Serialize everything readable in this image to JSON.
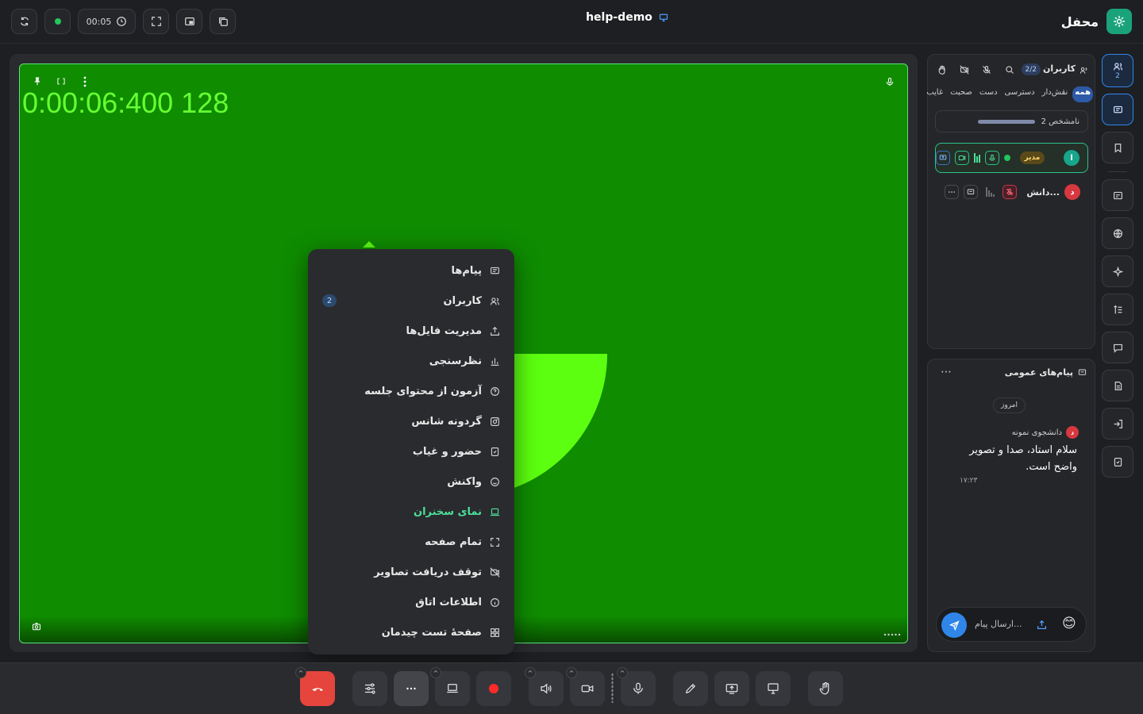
{
  "header": {
    "brand": "محفل",
    "room_title": "help-demo",
    "timer": "00:05"
  },
  "stage": {
    "timestamp": "0:00:06:400 128"
  },
  "menu": {
    "items": [
      {
        "label": "پیام‌ها",
        "icon": "message-icon"
      },
      {
        "label": "کاربران",
        "icon": "users-icon",
        "badge": "2"
      },
      {
        "label": "مدیریت فایل‌ها",
        "icon": "upload-icon"
      },
      {
        "label": "نظرسنجی",
        "icon": "chart-icon"
      },
      {
        "label": "آزمون از محتوای جلسه",
        "icon": "question-icon"
      },
      {
        "label": "گردونه شانس",
        "icon": "wheel-icon"
      },
      {
        "label": "حضور و غیاب",
        "icon": "attendance-icon"
      },
      {
        "label": "واکنش",
        "icon": "smile-icon"
      },
      {
        "label": "نمای سخنران",
        "icon": "laptop-icon",
        "active": true
      },
      {
        "label": "تمام صفحه",
        "icon": "fullscreen-icon"
      },
      {
        "label": "توقف دریافت تصاویر",
        "icon": "video-off-icon"
      },
      {
        "label": "اطلاعات اتاق",
        "icon": "info-icon"
      },
      {
        "label": "صفحهٔ تست چیدمان",
        "icon": "grid-icon"
      }
    ]
  },
  "users_panel": {
    "title": "کاربران",
    "count": "2/2",
    "filters": [
      "همه",
      "نقش‌دار",
      "دسترسی",
      "دست",
      "صحبت",
      "غایب"
    ],
    "unknown_label": "2 نامشخص",
    "users": [
      {
        "initial": "ا",
        "role": "مدیر",
        "name": ""
      },
      {
        "initial": "د",
        "name": "دانش..."
      }
    ]
  },
  "chat": {
    "title": "پیام‌های عمومی",
    "more": "⋯",
    "day_label": "امروز",
    "author_initial": "د",
    "author": "دانشجوی نمونه",
    "message": "سلام استاد، صدا و تصویر واضح است.",
    "time": "۱۷:۲۳",
    "placeholder": "ارسال پیام...",
    "emoji": "😊"
  },
  "rail": {
    "users_count": "2"
  },
  "colors": {
    "stage_bg": "#0f8c00",
    "accent_green": "#1aa37a",
    "accent_blue": "#2f86e8",
    "hangup_red": "#e5453d",
    "record_red": "#ff2b2b"
  }
}
